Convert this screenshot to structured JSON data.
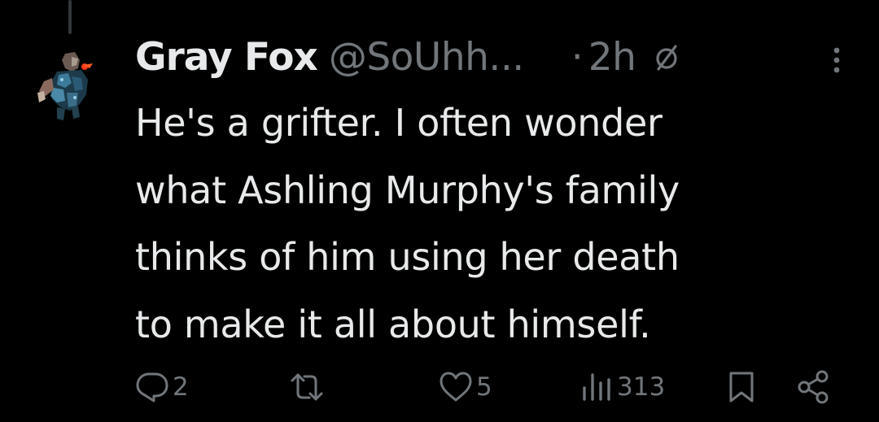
{
  "tweet": {
    "display_name": "Gray Fox",
    "handle": "@SoUhh...",
    "separator": "·",
    "timestamp": "2h",
    "text_lines": [
      "He's a grifter. I often wonder",
      "what Ashling Murphy's family",
      "thinks of him using her death",
      "to make it all about himself."
    ]
  },
  "actions": {
    "reply_count": "2",
    "repost_count": "",
    "like_count": "5",
    "views_count": "313"
  },
  "icons": {
    "reply": "reply-icon",
    "repost": "repost-icon",
    "like": "heart-icon",
    "views": "views-icon",
    "bookmark": "bookmark-icon",
    "share": "share-icon",
    "more": "more-icon",
    "edited": "edited-icon"
  },
  "colors": {
    "background": "#000000",
    "primary_text": "#e7e9ea",
    "secondary_text": "#71767b"
  }
}
